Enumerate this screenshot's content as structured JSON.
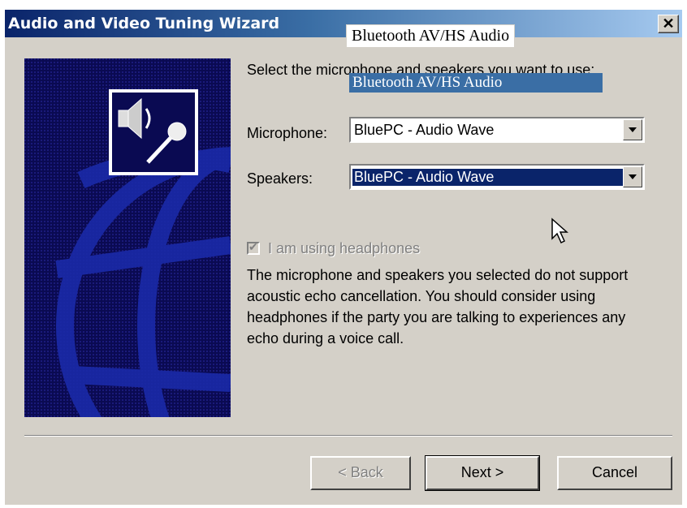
{
  "window": {
    "title": "Audio and Video Tuning Wizard",
    "close_glyph": "✕"
  },
  "tooltip": {
    "text": "Bluetooth AV/HS Audio"
  },
  "instruction": "Select the microphone and speakers you want to use:",
  "highlight_text": "Bluetooth AV/HS Audio",
  "microphone": {
    "label": "Microphone:",
    "value": "BluePC - Audio Wave"
  },
  "speakers": {
    "label": "Speakers:",
    "value": "BluePC - Audio Wave"
  },
  "headphones": {
    "label": "I am using headphones",
    "checked": true,
    "enabled": false
  },
  "message": "The microphone and speakers you selected do not support acoustic echo cancellation. You should consider using headphones if the party you are talking to experiences any echo during a voice call.",
  "buttons": {
    "back": "< Back",
    "next": "Next >",
    "cancel": "Cancel"
  },
  "icons": {
    "side_icon": "speaker-microphone-icon",
    "cursor": "mouse-cursor-icon"
  },
  "colors": {
    "title_start": "#0a246a",
    "title_end": "#a6caf0",
    "selection": "#0a246a",
    "dialog_bg": "#d4d0c8"
  }
}
